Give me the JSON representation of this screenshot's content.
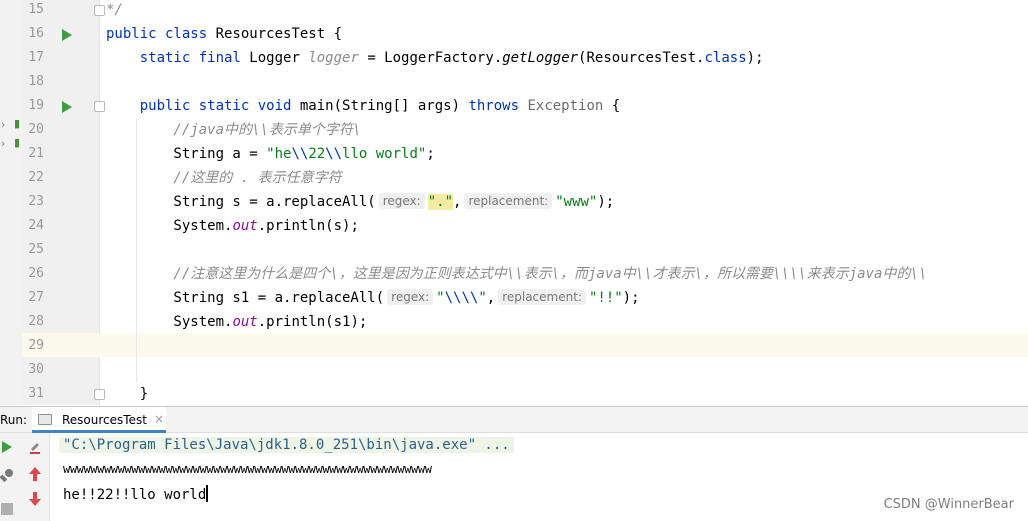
{
  "editor": {
    "lines": [
      {
        "num": "15",
        "tokens": [
          {
            "t": "*/",
            "c": "cmt"
          }
        ]
      },
      {
        "num": "16",
        "tokens": [
          {
            "t": "public class ",
            "c": "kw"
          },
          {
            "t": "ResourcesTest {",
            "c": "cls"
          }
        ]
      },
      {
        "num": "17",
        "tokens": [
          {
            "t": "    static final ",
            "c": "kw"
          },
          {
            "t": "Logger ",
            "c": "cls"
          },
          {
            "t": "logger",
            "c": "it-grey"
          },
          {
            "t": " = LoggerFactory.",
            "c": "cls"
          },
          {
            "t": "getLogger",
            "c": "it-call"
          },
          {
            "t": "(ResourcesTest.",
            "c": "cls"
          },
          {
            "t": "class",
            "c": "kw"
          },
          {
            "t": ");",
            "c": "cls"
          }
        ]
      },
      {
        "num": "18",
        "tokens": []
      },
      {
        "num": "19",
        "tokens": [
          {
            "t": "    public static void ",
            "c": "kw"
          },
          {
            "t": "main(String[] args) ",
            "c": "cls"
          },
          {
            "t": "throws ",
            "c": "kw"
          },
          {
            "t": "Exception",
            "c": "grey"
          },
          {
            "t": " {",
            "c": "cls"
          }
        ]
      },
      {
        "num": "20",
        "tokens": [
          {
            "t": "        //java中的\\\\表示单个字符\\",
            "c": "cmt"
          }
        ]
      },
      {
        "num": "21",
        "tokens": [
          {
            "t": "        String a = ",
            "c": "cls"
          },
          {
            "t": "\"he",
            "c": "str"
          },
          {
            "t": "\\\\",
            "c": "esc"
          },
          {
            "t": "22",
            "c": "str"
          },
          {
            "t": "\\\\",
            "c": "esc"
          },
          {
            "t": "llo world\"",
            "c": "str"
          },
          {
            "t": ";",
            "c": "cls"
          }
        ]
      },
      {
        "num": "22",
        "tokens": [
          {
            "t": "        //这里的 . 表示任意字符",
            "c": "cmt"
          }
        ]
      },
      {
        "num": "23",
        "tokens": [
          {
            "t": "        String s = a.replaceAll(",
            "c": "cls"
          },
          {
            "t": "regex:",
            "c": "hint"
          },
          {
            "t": "\".\"",
            "c": "str match"
          },
          {
            "t": ",",
            "c": "cls"
          },
          {
            "t": "replacement:",
            "c": "hint"
          },
          {
            "t": "\"www\"",
            "c": "str"
          },
          {
            "t": ");",
            "c": "cls"
          }
        ]
      },
      {
        "num": "24",
        "tokens": [
          {
            "t": "        System.",
            "c": "cls"
          },
          {
            "t": "out",
            "c": "it-field"
          },
          {
            "t": ".println(s);",
            "c": "cls"
          }
        ]
      },
      {
        "num": "25",
        "tokens": []
      },
      {
        "num": "26",
        "tokens": [
          {
            "t": "        //注意这里为什么是四个\\，这里是因为正则表达式中\\\\表示\\，而java中\\\\才表示\\，所以需要\\\\\\\\来表示java中的\\\\",
            "c": "cmt"
          }
        ]
      },
      {
        "num": "27",
        "tokens": [
          {
            "t": "        String s1 = a.replaceAll(",
            "c": "cls"
          },
          {
            "t": "regex:",
            "c": "hint"
          },
          {
            "t": "\"",
            "c": "str"
          },
          {
            "t": "\\\\\\\\",
            "c": "esc"
          },
          {
            "t": "\"",
            "c": "str"
          },
          {
            "t": ",",
            "c": "cls"
          },
          {
            "t": "replacement:",
            "c": "hint"
          },
          {
            "t": "\"!!\"",
            "c": "str"
          },
          {
            "t": ");",
            "c": "cls"
          }
        ]
      },
      {
        "num": "28",
        "tokens": [
          {
            "t": "        System.",
            "c": "cls"
          },
          {
            "t": "out",
            "c": "it-field"
          },
          {
            "t": ".println(s1);",
            "c": "cls"
          }
        ]
      },
      {
        "num": "29",
        "tokens": []
      },
      {
        "num": "30",
        "tokens": []
      },
      {
        "num": "31",
        "tokens": [
          {
            "t": "    }",
            "c": "cls"
          }
        ]
      }
    ],
    "run_gutter_lines": [
      "16",
      "19"
    ],
    "fold_lines": [
      "15",
      "19",
      "31"
    ],
    "current_line": "29"
  },
  "run_panel": {
    "label": "Run:",
    "tab_label": "ResourcesTest",
    "tab_close": "×",
    "command": "\"C:\\Program Files\\Java\\jdk1.8.0_251\\bin\\java.exe\" ...",
    "output": [
      "wwwwwwwwwwwwwwwwwwwwwwwwwwwwwwwwwwwwwwwwwwwwwwwwwwwwww",
      "he!!22!!llo world"
    ],
    "toolbar_icons": [
      "run-icon",
      "rerun-icon",
      "up-arrow-icon",
      "wrench-icon",
      "down-arrow-icon",
      "stop-icon"
    ]
  },
  "watermark": "CSDN @WinnerBear",
  "colors": {
    "keyword": "#0033b3",
    "string": "#067d17",
    "comment": "#8c8c8c",
    "field": "#871094",
    "run_arrow": "#3f9c3f",
    "tab_accent": "#4083c9"
  }
}
